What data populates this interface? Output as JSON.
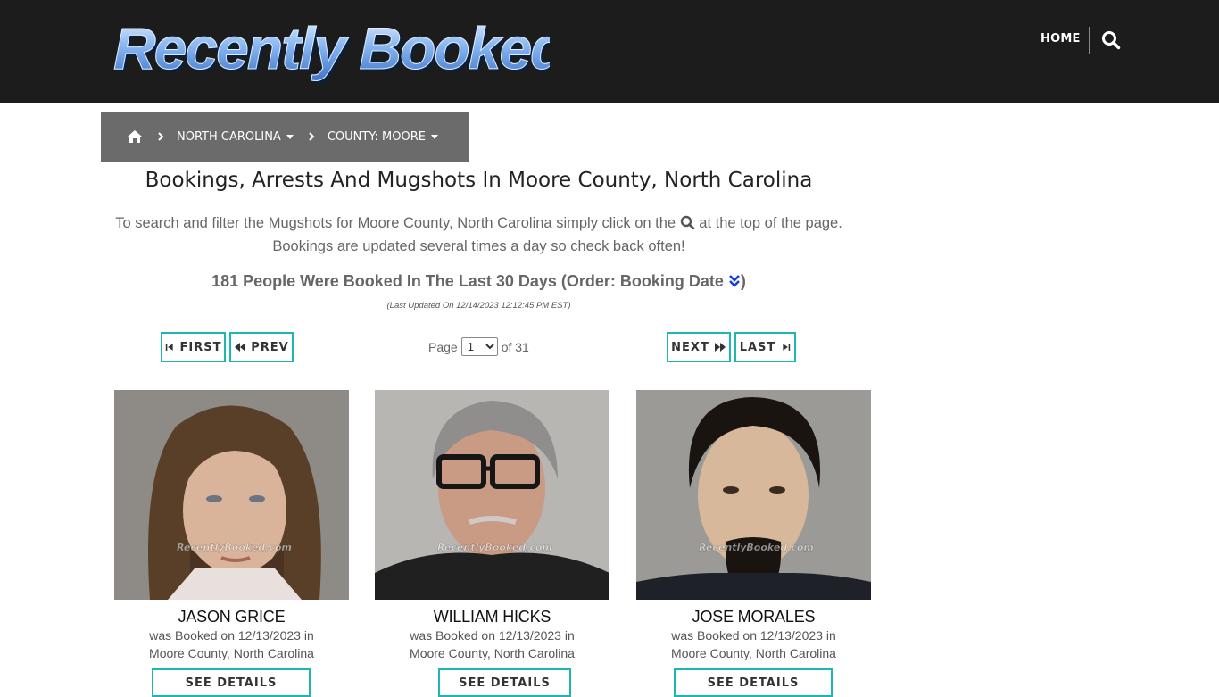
{
  "header": {
    "logo_text": "Recently Booked",
    "nav_home": "HOME",
    "search_icon": "search-icon"
  },
  "breadcrumb": {
    "home_icon": "home-icon",
    "state": "NORTH CAROLINA",
    "county": "COUNTY: MOORE"
  },
  "main": {
    "title": "Bookings, Arrests And Mugshots In Moore County, North Carolina",
    "intro_part1": "To search and filter the Mugshots for Moore County, North Carolina simply click on the",
    "intro_part2": "at the top of the page.",
    "intro_line2": "Bookings are updated several times a day so check back often!",
    "count_text": "181 People Were Booked In The Last 30 Days (Order: Booking Date",
    "count_close": ")",
    "updated": "(Last Updated On 12/14/2023 12:12:45 PM EST)"
  },
  "pager": {
    "first": "FIRST",
    "prev": "PREV",
    "next": "NEXT",
    "last": "LAST",
    "page_label": "Page",
    "current_page": "1",
    "of_label": "of 31"
  },
  "bookings": [
    {
      "name": "JASON GRICE",
      "booked_line": "was Booked on 12/13/2023 in",
      "location": "Moore County, North Carolina",
      "details": "SEE DETAILS",
      "watermark": "RecentlyBooked.com"
    },
    {
      "name": "WILLIAM HICKS",
      "booked_line": "was Booked on 12/13/2023 in",
      "location": "Moore County, North Carolina",
      "details": "SEE DETAILS",
      "watermark": "RecentlyBooked.com"
    },
    {
      "name": "JOSE MORALES",
      "booked_line": "was Booked on 12/13/2023 in",
      "location": "Moore County, North Carolina",
      "details": "SEE DETAILS",
      "watermark": "RecentlyBooked.com"
    }
  ],
  "colors": {
    "header_bg": "#1c1c1c",
    "breadcrumb_bg": "#6b6b6b",
    "accent": "#1fb5b0",
    "logo_blue": "#6fa8f0"
  }
}
